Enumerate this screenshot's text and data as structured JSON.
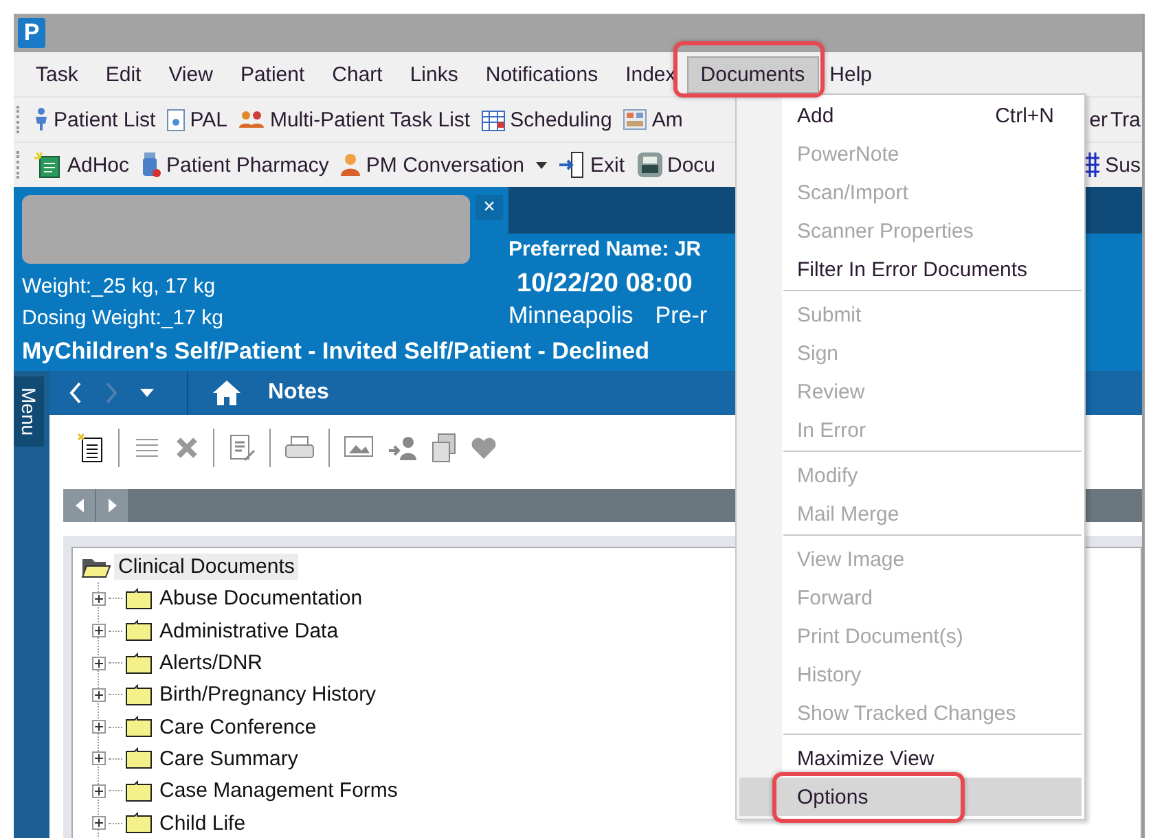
{
  "app_icon": {
    "letter": "P"
  },
  "menu_bar": [
    {
      "label": "Task",
      "selected": false,
      "annotated": false
    },
    {
      "label": "Edit",
      "selected": false,
      "annotated": false
    },
    {
      "label": "View",
      "selected": false,
      "annotated": false
    },
    {
      "label": "Patient",
      "selected": false,
      "annotated": false
    },
    {
      "label": "Chart",
      "selected": false,
      "annotated": false
    },
    {
      "label": "Links",
      "selected": false,
      "annotated": false
    },
    {
      "label": "Notifications",
      "selected": false,
      "annotated": false
    },
    {
      "label": "Index",
      "selected": false,
      "annotated": false
    },
    {
      "label": "Documents",
      "selected": true,
      "annotated": true
    },
    {
      "label": "Help",
      "selected": false,
      "annotated": false
    }
  ],
  "toolbars": [
    {
      "left": [
        {
          "label": "Patient List"
        },
        {
          "label": "PAL"
        },
        {
          "label": "Multi-Patient Task List"
        },
        {
          "label": "Scheduling"
        },
        {
          "label": "Am"
        }
      ],
      "right": [
        {
          "label": "er"
        },
        {
          "label": "Tra"
        }
      ]
    },
    {
      "left": [
        {
          "label": "AdHoc",
          "dropdown": false
        },
        {
          "label": "Patient Pharmacy",
          "dropdown": false
        },
        {
          "label": "PM Conversation",
          "dropdown": true
        },
        {
          "label": "Exit",
          "dropdown": false
        },
        {
          "label": "Docu",
          "dropdown": false
        }
      ],
      "right": [
        {
          "label": "Sus"
        }
      ]
    }
  ],
  "patient_tab": {
    "close": "×"
  },
  "banner": {
    "weight": "Weight:_25 kg, 17 kg",
    "dosing_weight": "Dosing Weight:_17 kg",
    "preferred_name": "Preferred Name: JR",
    "datetime": "10/22/20 08:00",
    "location": "Minneapolis",
    "location_status": "Pre-r",
    "portal_status": "MyChildren's Self/Patient - Invited Self/Patient - Declined"
  },
  "side_tab": "Menu",
  "nav": {
    "title": "Notes"
  },
  "tree": {
    "label": "Clinical Documents",
    "expanded": true,
    "selected": true,
    "children": [
      {
        "label": "Abuse Documentation",
        "expanded": false,
        "selected": false
      },
      {
        "label": "Administrative Data",
        "expanded": false,
        "selected": false
      },
      {
        "label": "Alerts/DNR",
        "expanded": false,
        "selected": false
      },
      {
        "label": "Birth/Pregnancy History",
        "expanded": false,
        "selected": false
      },
      {
        "label": "Care Conference",
        "expanded": false,
        "selected": false
      },
      {
        "label": "Care Summary",
        "expanded": false,
        "selected": false
      },
      {
        "label": "Case Management Forms",
        "expanded": false,
        "selected": false
      },
      {
        "label": "Child Life",
        "expanded": false,
        "selected": false
      }
    ]
  },
  "dropdown": {
    "groups": [
      [
        {
          "label": "Add",
          "shortcut": "Ctrl+N",
          "disabled": false,
          "selected": false,
          "annotated": false
        },
        {
          "label": "PowerNote",
          "disabled": true,
          "selected": false,
          "annotated": false
        },
        {
          "label": "Scan/Import",
          "disabled": true,
          "selected": false,
          "annotated": false
        },
        {
          "label": "Scanner Properties",
          "disabled": true,
          "selected": false,
          "annotated": false
        },
        {
          "label": "Filter In Error Documents",
          "disabled": false,
          "selected": false,
          "annotated": false
        }
      ],
      [
        {
          "label": "Submit",
          "disabled": true,
          "selected": false,
          "annotated": false
        },
        {
          "label": "Sign",
          "disabled": true,
          "selected": false,
          "annotated": false
        },
        {
          "label": "Review",
          "disabled": true,
          "selected": false,
          "annotated": false
        },
        {
          "label": "In Error",
          "disabled": true,
          "selected": false,
          "annotated": false
        }
      ],
      [
        {
          "label": "Modify",
          "disabled": true,
          "selected": false,
          "annotated": false
        },
        {
          "label": "Mail Merge",
          "disabled": true,
          "selected": false,
          "annotated": false
        }
      ],
      [
        {
          "label": "View Image",
          "disabled": true,
          "selected": false,
          "annotated": false
        },
        {
          "label": "Forward",
          "disabled": true,
          "selected": false,
          "annotated": false
        },
        {
          "label": "Print Document(s)",
          "disabled": true,
          "selected": false,
          "annotated": false
        },
        {
          "label": "History",
          "disabled": true,
          "selected": false,
          "annotated": false
        },
        {
          "label": "Show Tracked Changes",
          "disabled": true,
          "selected": false,
          "annotated": false
        }
      ],
      [
        {
          "label": "Maximize View",
          "disabled": false,
          "selected": false,
          "annotated": false
        },
        {
          "label": "Options",
          "disabled": false,
          "selected": true,
          "annotated": true
        }
      ]
    ]
  }
}
